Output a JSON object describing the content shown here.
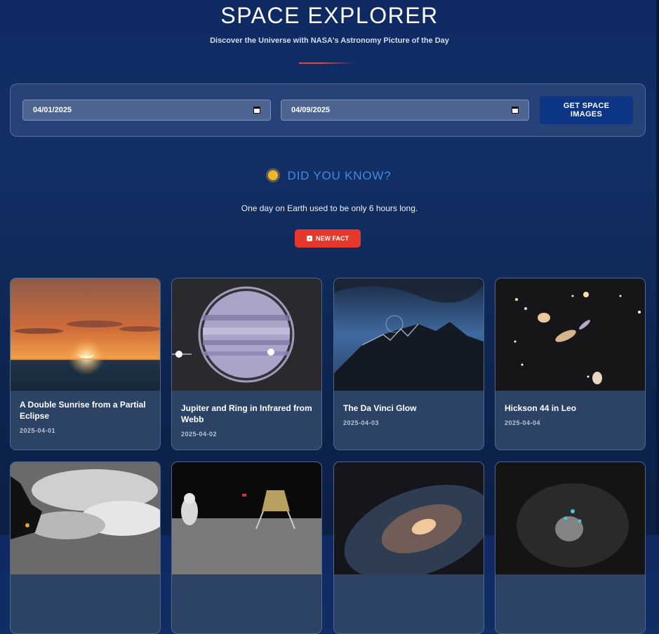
{
  "header": {
    "title": "SPACE EXPLORER",
    "subtitle": "Discover the Universe with NASA's Astronomy Picture of the Day"
  },
  "search": {
    "start_date": "04/01/2025",
    "end_date": "04/09/2025",
    "button_label": "GET SPACE IMAGES",
    "calendar_icon": "calendar-icon"
  },
  "fact": {
    "heading": "DID YOU KNOW?",
    "icon": "sun-icon",
    "text": "One day on Earth used to be only 6 hours long.",
    "button_label": "NEW FACT",
    "button_icon": "die-icon"
  },
  "gallery": {
    "cards": [
      {
        "title": "A Double Sunrise from a Partial Eclipse",
        "date": "2025-04-01"
      },
      {
        "title": "Jupiter and Ring in Infrared from Webb",
        "date": "2025-04-02"
      },
      {
        "title": "The Da Vinci Glow",
        "date": "2025-04-03"
      },
      {
        "title": "Hickson 44 in Leo",
        "date": "2025-04-04"
      }
    ]
  },
  "colors": {
    "accent_red": "#e6392b",
    "button_blue": "#0d3586",
    "fact_heading": "#3d8be8"
  }
}
